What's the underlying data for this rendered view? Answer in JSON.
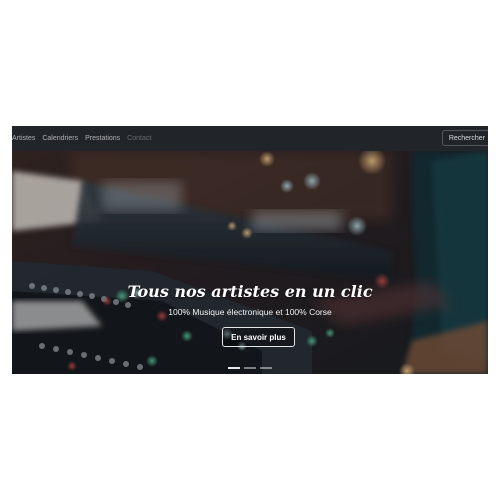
{
  "navbar": {
    "links": [
      {
        "label": "Artistes"
      },
      {
        "label": "Calendriers"
      },
      {
        "label": "Prestations"
      },
      {
        "label": "Contact"
      }
    ],
    "search_label": "Rechercher"
  },
  "hero": {
    "title": "Tous nos artistes en un clic",
    "subtitle": "100% Musique électronique et 100% Corse",
    "button_label": "En savoir plus"
  },
  "colors": {
    "navbar_bg": "#212529",
    "page_bg": "#ffffff"
  }
}
